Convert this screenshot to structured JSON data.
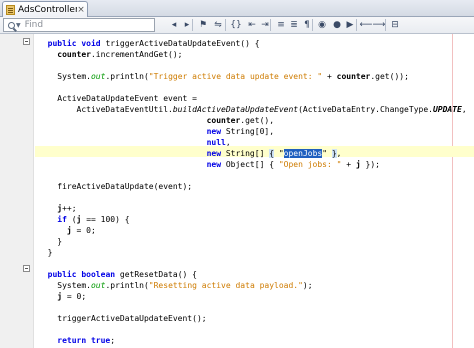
{
  "tab": {
    "filename": "AdsController.java",
    "close": "×"
  },
  "toolbar": {
    "find_placeholder": "Find",
    "buttons": [
      {
        "name": "go-back-icon",
        "glyph": "◂"
      },
      {
        "name": "go-forward-icon",
        "glyph": "▸"
      },
      {
        "name": "bookmark-icon",
        "glyph": "⚑"
      },
      {
        "name": "find-selection-icon",
        "glyph": "⇋"
      },
      {
        "name": "toggle-brackets-icon",
        "glyph": "{}"
      },
      {
        "name": "shift-left-icon",
        "glyph": "⇤"
      },
      {
        "name": "shift-right-icon",
        "glyph": "⇥"
      },
      {
        "name": "comment-icon",
        "glyph": "≡"
      },
      {
        "name": "uncomment-icon",
        "glyph": "≣"
      },
      {
        "name": "format-icon",
        "glyph": "¶"
      },
      {
        "name": "mark-occurrences-icon",
        "glyph": "◉"
      },
      {
        "name": "macro-record-icon",
        "glyph": "●"
      },
      {
        "name": "macro-play-icon",
        "glyph": "▶"
      },
      {
        "name": "find-prev-icon",
        "glyph": "⟵"
      },
      {
        "name": "find-next-icon",
        "glyph": "⟶"
      },
      {
        "name": "diff-icon",
        "glyph": "⊟"
      }
    ]
  },
  "code": {
    "l1_kw": "public void",
    "l1_rest": " triggerActiveDataUpdateEvent() {",
    "l2_ident": "counter",
    "l2_rest": ".incrementAndGet();",
    "l3_a": "System.",
    "l3_field": "out",
    "l3_b": ".println(",
    "l3_str": "\"Trigger active data update event: \"",
    "l3_c": " + ",
    "l3_ident": "counter",
    "l3_d": ".get());",
    "l4": "ActiveDataUpdateEvent event =",
    "l5_a": "ActiveDataEventUtil.",
    "l5_ital": "buildActiveDataUpdateEvent",
    "l5_b": "(ActiveDataEntry.ChangeType.",
    "l5_field": "UPDATE",
    "l5_c": ",",
    "l6_ident": "counter",
    "l6_rest": ".get(),",
    "l7_kw": "new",
    "l7_rest": " String[0],",
    "l8_kw": "null",
    "l8_rest": ",",
    "l9_kw": "new",
    "l9_a": " String[] ",
    "l9_brace1": "{",
    "l9_q1": " \"",
    "l9_sel": "openJobs",
    "l9_q2": "\" ",
    "l9_brace2": "}",
    "l9_end": ",",
    "l10_kw": "new",
    "l10_a": " Object[] { ",
    "l10_str": "\"Open jobs: \"",
    "l10_b": " + ",
    "l10_ident": "j",
    "l10_c": " });",
    "l11": "fireActiveDataUpdate(event);",
    "l12_ident": "j",
    "l12_rest": "++;",
    "l13_kw": "if",
    "l13_a": " (",
    "l13_ident": "j",
    "l13_b": " == ",
    "l13_num": "100",
    "l13_c": ") {",
    "l14_ident": "j",
    "l14_rest": " = 0;",
    "l15": "}",
    "l16": "}",
    "l17_kw": "public boolean",
    "l17_rest": " getResetData() {",
    "l18_a": "System.",
    "l18_field": "out",
    "l18_b": ".println(",
    "l18_str": "\"Resetting active data payload.\"",
    "l18_c": ");",
    "l19_ident": "j",
    "l19_rest": " = 0;",
    "l20": "triggerActiveDataUpdateEvent();",
    "l21_kw": "return true",
    "l21_rest": ";"
  }
}
